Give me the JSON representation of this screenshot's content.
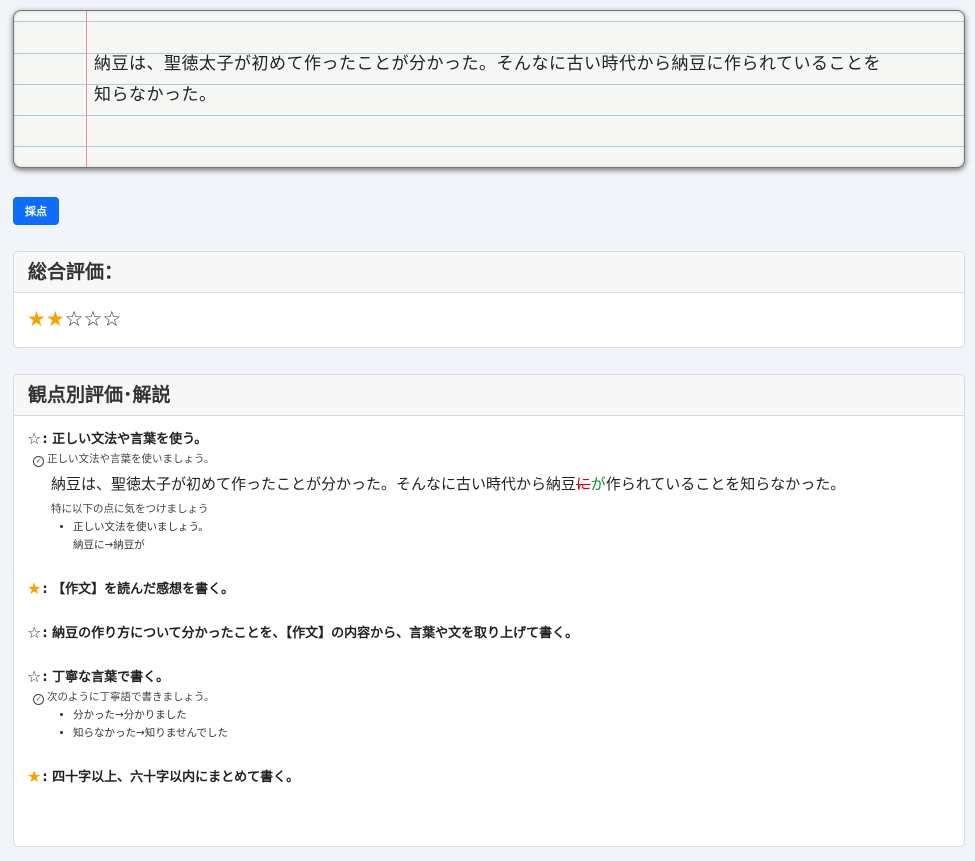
{
  "essay": {
    "text": "納豆は、聖徳太子が初めて作ったことが分かった。そんなに古い時代から納豆に作られていることを知らなかった。"
  },
  "grade_button": {
    "label": "採点"
  },
  "overall": {
    "title": "総合評価：",
    "rating": 2,
    "max": 5
  },
  "detail": {
    "title": "観点別評価･解説",
    "items": [
      {
        "star": "☆",
        "filled": false,
        "title": ": 正しい文法や言葉を使う。",
        "hint": "正しい文法や言葉を使いましょう。",
        "example_before": "納豆は、聖徳太子が初めて作ったことが分かった。そんなに古い時代から納豆",
        "example_del": "に",
        "example_ins": "が",
        "example_after": "作られていることを知らなかった。",
        "note": "特に以下の点に気をつけましょう",
        "points": [
          {
            "label": "正しい文法を使いましょう。",
            "fix": "納豆に→納豆が"
          }
        ]
      },
      {
        "star": "★",
        "filled": true,
        "title": ": 【作文】を読んだ感想を書く。"
      },
      {
        "star": "☆",
        "filled": false,
        "title": ": 納豆の作り方について分かったことを、【作文】の内容から、言葉や文を取り上げて書く。"
      },
      {
        "star": "☆",
        "filled": false,
        "title": ": 丁寧な言葉で書く。",
        "hint": "次のように丁寧語で書きましょう。",
        "points": [
          {
            "label": "分かった→分かりました"
          },
          {
            "label": "知らなかった→知りませんでした"
          }
        ]
      },
      {
        "star": "★",
        "filled": true,
        "title": ": 四十字以上、六十字以内にまとめて書く。"
      }
    ]
  },
  "colors": {
    "accent": "#0d6efd",
    "star_on": "#f6a300",
    "deleted": "#d0021b",
    "inserted": "#1a8a2a"
  }
}
